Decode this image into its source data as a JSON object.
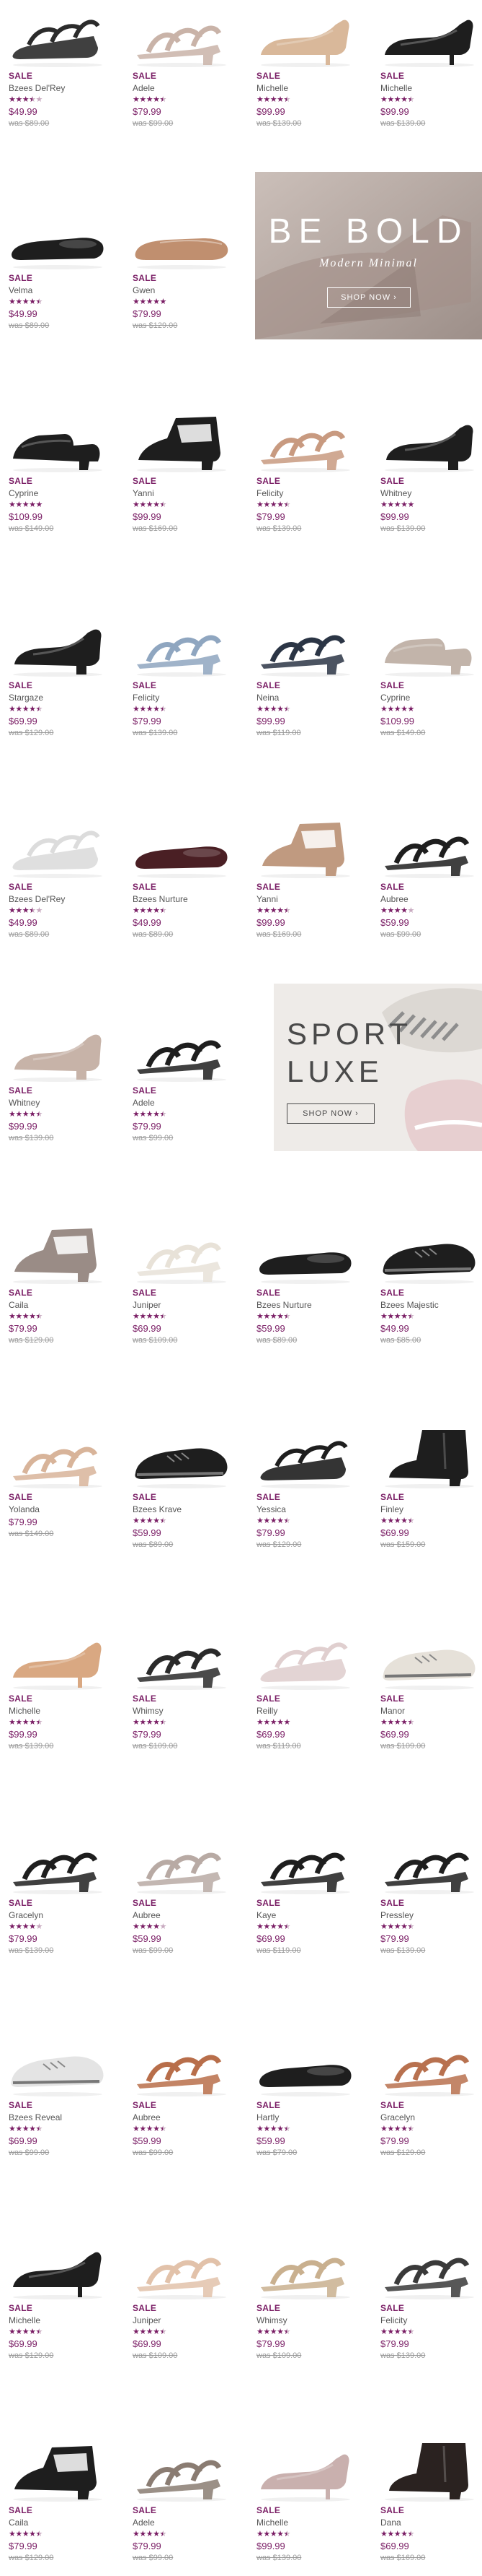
{
  "colors": {
    "accent": "#7a1e65",
    "was_price": "#999999"
  },
  "promos": [
    {
      "title": "BE BOLD",
      "subtitle": "Modern Minimal",
      "button": "SHOP NOW"
    },
    {
      "title_line1": "SPORT",
      "title_line2": "LUXE",
      "button": "SHOP NOW"
    }
  ],
  "products": [
    {
      "sale": "SALE",
      "name": "Bzees Del'Rey",
      "rating": 3.5,
      "stars": "★★★½☆",
      "price": "$49.99",
      "was": "was $89.00",
      "shoe": "wedge-sandal",
      "color": "#2b2b2b"
    },
    {
      "sale": "SALE",
      "name": "Adele",
      "rating": 4.5,
      "stars": "★★★★½",
      "price": "$79.99",
      "was": "was $99.00",
      "shoe": "strap-sandal",
      "color": "#c9b3a8"
    },
    {
      "sale": "SALE",
      "name": "Michelle",
      "rating": 4.5,
      "stars": "★★★★½",
      "price": "$99.99",
      "was": "was $139.00",
      "shoe": "pump",
      "color": "#d9b89a"
    },
    {
      "sale": "SALE",
      "name": "Michelle",
      "rating": 4.5,
      "stars": "★★★★½",
      "price": "$99.99",
      "was": "was $139.00",
      "shoe": "pump",
      "color": "#1e1e1e"
    },
    {
      "sale": "SALE",
      "name": "Velma",
      "rating": 4.5,
      "stars": "★★★★½",
      "price": "$49.99",
      "was": "was $89.00",
      "shoe": "flat",
      "color": "#1e1e1e"
    },
    {
      "sale": "SALE",
      "name": "Gwen",
      "rating": 5,
      "stars": "★★★★★",
      "price": "$79.99",
      "was": "was $129.00",
      "shoe": "loafer",
      "color": "#c08f6f"
    },
    {
      "sale": "SALE",
      "name": "Cyprine",
      "rating": 5,
      "stars": "★★★★★",
      "price": "$109.99",
      "was": "was $149.00",
      "shoe": "mule",
      "color": "#1e1e1e"
    },
    {
      "sale": "SALE",
      "name": "Yanni",
      "rating": 4.5,
      "stars": "★★★★½",
      "price": "$99.99",
      "was": "was $169.00",
      "shoe": "bootie-open",
      "color": "#1e1e1e"
    },
    {
      "sale": "SALE",
      "name": "Felicity",
      "rating": 4.5,
      "stars": "★★★★½",
      "price": "$79.99",
      "was": "was $139.00",
      "shoe": "strap-sandal",
      "color": "#c89a80"
    },
    {
      "sale": "SALE",
      "name": "Whitney",
      "rating": 5,
      "stars": "★★★★★",
      "price": "$99.99",
      "was": "was $139.00",
      "shoe": "block-pump",
      "color": "#1e1e1e"
    },
    {
      "sale": "SALE",
      "name": "Stargaze",
      "rating": 4.5,
      "stars": "★★★★½",
      "price": "$69.99",
      "was": "was $129.00",
      "shoe": "block-pump",
      "color": "#1e1e1e"
    },
    {
      "sale": "SALE",
      "name": "Felicity",
      "rating": 4.5,
      "stars": "★★★★½",
      "price": "$79.99",
      "was": "was $139.00",
      "shoe": "strap-sandal",
      "color": "#8fa6c0"
    },
    {
      "sale": "SALE",
      "name": "Neina",
      "rating": 4.5,
      "stars": "★★★★½",
      "price": "$99.99",
      "was": "was $119.00",
      "shoe": "strap-sandal",
      "color": "#2b3545"
    },
    {
      "sale": "SALE",
      "name": "Cyprine",
      "rating": 5,
      "stars": "★★★★★",
      "price": "$109.99",
      "was": "was $149.00",
      "shoe": "mule",
      "color": "#c2b4aa"
    },
    {
      "sale": "SALE",
      "name": "Bzees Del'Rey",
      "rating": 3.5,
      "stars": "★★★½☆",
      "price": "$49.99",
      "was": "was $89.00",
      "shoe": "wedge-sandal",
      "color": "#dcdcdc"
    },
    {
      "sale": "SALE",
      "name": "Bzees Nurture",
      "rating": 4.5,
      "stars": "★★★★½",
      "price": "$49.99",
      "was": "was $89.00",
      "shoe": "flat",
      "color": "#4a1f24"
    },
    {
      "sale": "SALE",
      "name": "Yanni",
      "rating": 4.5,
      "stars": "★★★★½",
      "price": "$99.99",
      "was": "was $169.00",
      "shoe": "bootie-open",
      "color": "#c09a80"
    },
    {
      "sale": "SALE",
      "name": "Aubree",
      "rating": 4,
      "stars": "★★★★☆",
      "price": "$59.99",
      "was": "was $99.00",
      "shoe": "strap-sandal",
      "color": "#1e1e1e"
    },
    {
      "sale": "SALE",
      "name": "Whitney",
      "rating": 4.5,
      "stars": "★★★★½",
      "price": "$99.99",
      "was": "was $139.00",
      "shoe": "block-pump",
      "color": "#c7b3a8"
    },
    {
      "sale": "SALE",
      "name": "Adele",
      "rating": 4.5,
      "stars": "★★★★½",
      "price": "$79.99",
      "was": "was $99.00",
      "shoe": "strap-sandal",
      "color": "#1e1e1e"
    },
    {
      "sale": "SALE",
      "name": "Caila",
      "rating": 4.5,
      "stars": "★★★★½",
      "price": "$79.99",
      "was": "was $129.00",
      "shoe": "bootie-open",
      "color": "#9a8c86"
    },
    {
      "sale": "SALE",
      "name": "Juniper",
      "rating": 4.5,
      "stars": "★★★★½",
      "price": "$69.99",
      "was": "was $109.00",
      "shoe": "strap-sandal",
      "color": "#e8e2d8"
    },
    {
      "sale": "SALE",
      "name": "Bzees Nurture",
      "rating": 4.5,
      "stars": "★★★★½",
      "price": "$59.99",
      "was": "was $89.00",
      "shoe": "flat",
      "color": "#1e1e1e"
    },
    {
      "sale": "SALE",
      "name": "Bzees Majestic",
      "rating": 4.5,
      "stars": "★★★★½",
      "price": "$49.99",
      "was": "was $85.00",
      "shoe": "sneaker",
      "color": "#1e1e1e"
    },
    {
      "sale": "SALE",
      "name": "Yolanda",
      "rating": 0,
      "stars": "",
      "price": "$79.99",
      "was": "was $149.00",
      "shoe": "strap-sandal",
      "color": "#d8b49a"
    },
    {
      "sale": "SALE",
      "name": "Bzees Krave",
      "rating": 4.5,
      "stars": "★★★★½",
      "price": "$59.99",
      "was": "was $89.00",
      "shoe": "sneaker",
      "color": "#1e1e1e"
    },
    {
      "sale": "SALE",
      "name": "Yessica",
      "rating": 4.5,
      "stars": "★★★★½",
      "price": "$79.99",
      "was": "was $129.00",
      "shoe": "wedge-sandal",
      "color": "#1e1e1e"
    },
    {
      "sale": "SALE",
      "name": "Finley",
      "rating": 4.5,
      "stars": "★★★★½",
      "price": "$69.99",
      "was": "was $159.00",
      "shoe": "boot",
      "color": "#1e1e1e"
    },
    {
      "sale": "SALE",
      "name": "Michelle",
      "rating": 4.5,
      "stars": "★★★★½",
      "price": "$99.99",
      "was": "was $139.00",
      "shoe": "pump",
      "color": "#d9a882"
    },
    {
      "sale": "SALE",
      "name": "Whimsy",
      "rating": 4.5,
      "stars": "★★★★½",
      "price": "$79.99",
      "was": "was $109.00",
      "shoe": "strap-sandal",
      "color": "#2a2a2a"
    },
    {
      "sale": "SALE",
      "name": "Reilly",
      "rating": 5,
      "stars": "★★★★★",
      "price": "$69.99",
      "was": "was $119.00",
      "shoe": "wedge-sandal",
      "color": "#e0cfcf"
    },
    {
      "sale": "SALE",
      "name": "Manor",
      "rating": 4.5,
      "stars": "★★★★½",
      "price": "$69.99",
      "was": "was $109.00",
      "shoe": "sneaker",
      "color": "#e6e1d9"
    },
    {
      "sale": "SALE",
      "name": "Gracelyn",
      "rating": 4,
      "stars": "★★★★☆",
      "price": "$79.99",
      "was": "was $139.00",
      "shoe": "strap-sandal",
      "color": "#1e1e1e"
    },
    {
      "sale": "SALE",
      "name": "Aubree",
      "rating": 4,
      "stars": "★★★★☆",
      "price": "$59.99",
      "was": "was $99.00",
      "shoe": "strap-sandal",
      "color": "#b8aaa4"
    },
    {
      "sale": "SALE",
      "name": "Kaye",
      "rating": 4.5,
      "stars": "★★★★½",
      "price": "$69.99",
      "was": "was $119.00",
      "shoe": "strap-sandal",
      "color": "#1e1e1e"
    },
    {
      "sale": "SALE",
      "name": "Pressley",
      "rating": 4.5,
      "stars": "★★★★½",
      "price": "$79.99",
      "was": "was $139.00",
      "shoe": "strap-sandal",
      "color": "#1e1e1e"
    },
    {
      "sale": "SALE",
      "name": "Bzees Reveal",
      "rating": 4.5,
      "stars": "★★★★½",
      "price": "$69.99",
      "was": "was $99.00",
      "shoe": "sneaker",
      "color": "#e4e4e4"
    },
    {
      "sale": "SALE",
      "name": "Aubree",
      "rating": 4.5,
      "stars": "★★★★½",
      "price": "$59.99",
      "was": "was $99.00",
      "shoe": "strap-sandal",
      "color": "#b86e4a"
    },
    {
      "sale": "SALE",
      "name": "Hartly",
      "rating": 4.5,
      "stars": "★★★★½",
      "price": "$59.99",
      "was": "was $79.00",
      "shoe": "flat",
      "color": "#1e1e1e"
    },
    {
      "sale": "SALE",
      "name": "Gracelyn",
      "rating": 4.5,
      "stars": "★★★★½",
      "price": "$79.99",
      "was": "was $129.00",
      "shoe": "strap-sandal",
      "color": "#b8714f"
    },
    {
      "sale": "SALE",
      "name": "Michelle",
      "rating": 4.5,
      "stars": "★★★★½",
      "price": "$69.99",
      "was": "was $129.00",
      "shoe": "pump",
      "color": "#1e1e1e"
    },
    {
      "sale": "SALE",
      "name": "Juniper",
      "rating": 4.5,
      "stars": "★★★★½",
      "price": "$69.99",
      "was": "was $109.00",
      "shoe": "strap-sandal",
      "color": "#e2c2aa"
    },
    {
      "sale": "SALE",
      "name": "Whimsy",
      "rating": 4.5,
      "stars": "★★★★½",
      "price": "$79.99",
      "was": "was $109.00",
      "shoe": "strap-sandal",
      "color": "#c9b08f"
    },
    {
      "sale": "SALE",
      "name": "Felicity",
      "rating": 4.5,
      "stars": "★★★★½",
      "price": "$79.99",
      "was": "was $139.00",
      "shoe": "strap-sandal",
      "color": "#3a3a3a"
    },
    {
      "sale": "SALE",
      "name": "Caila",
      "rating": 4.5,
      "stars": "★★★★½",
      "price": "$79.99",
      "was": "was $129.00",
      "shoe": "bootie-open",
      "color": "#1e1e1e"
    },
    {
      "sale": "SALE",
      "name": "Adele",
      "rating": 4.5,
      "stars": "★★★★½",
      "price": "$79.99",
      "was": "was $99.00",
      "shoe": "strap-sandal",
      "color": "#8a7c72"
    },
    {
      "sale": "SALE",
      "name": "Michelle",
      "rating": 4.5,
      "stars": "★★★★½",
      "price": "$99.99",
      "was": "was $139.00",
      "shoe": "pump",
      "color": "#c9b0ae"
    },
    {
      "sale": "SALE",
      "name": "Dana",
      "rating": 4.5,
      "stars": "★★★★½",
      "price": "$69.99",
      "was": "was $169.00",
      "shoe": "boot",
      "color": "#2a2220"
    }
  ]
}
